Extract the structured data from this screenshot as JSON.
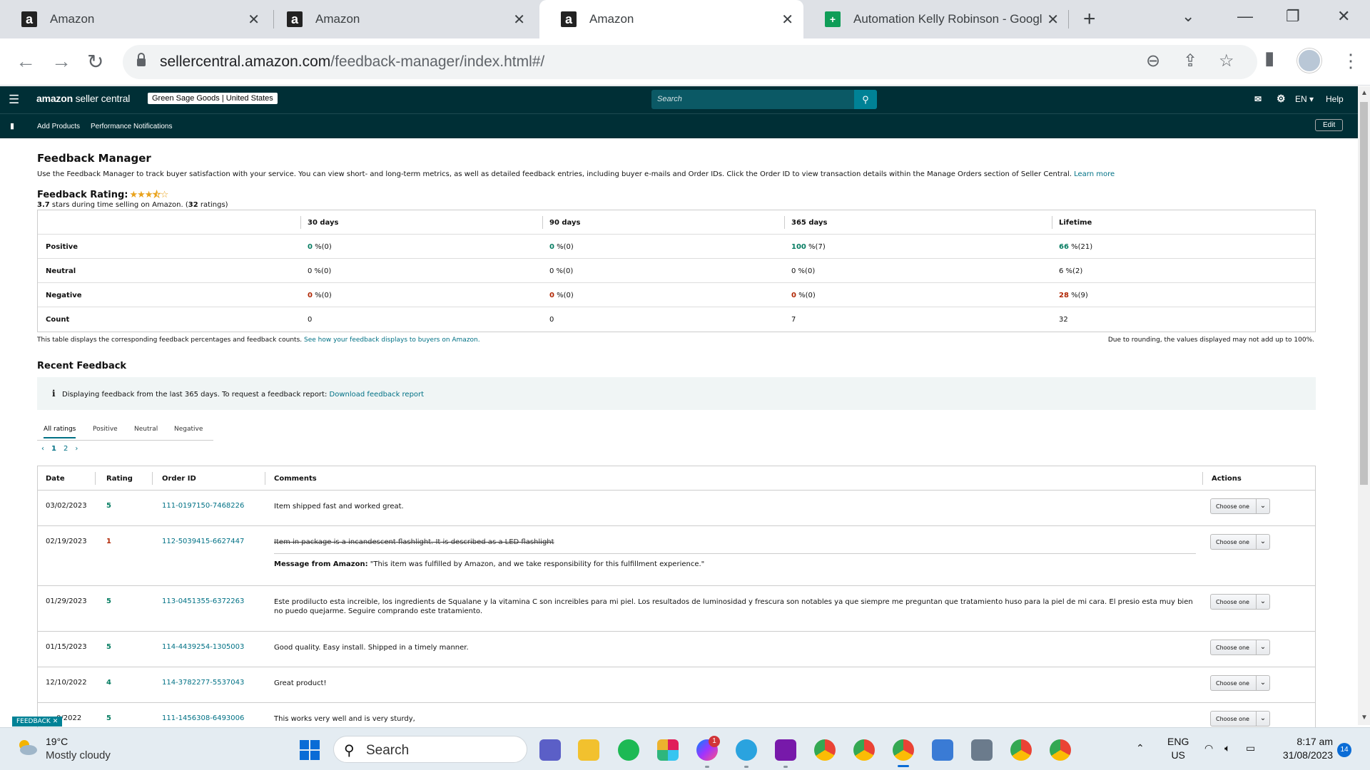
{
  "browser": {
    "tabs": [
      {
        "label": "Amazon",
        "favicon": "a"
      },
      {
        "label": "Amazon",
        "favicon": "a"
      },
      {
        "label": "Amazon",
        "favicon": "a"
      },
      {
        "label": "Automation Kelly Robinson - Googl",
        "favicon": "+"
      }
    ],
    "url_domain": "sellercentral.amazon.com",
    "url_path": "/feedback-manager/index.html#/"
  },
  "header": {
    "logo_main": "amazon",
    "logo_sub": " seller central",
    "store": "Green Sage Goods | United States",
    "search_placeholder": "Search",
    "lang": "EN ▾",
    "help": "Help",
    "nav": [
      "Add Products",
      "Performance Notifications"
    ],
    "edit": "Edit"
  },
  "page": {
    "title": "Feedback Manager",
    "desc": "Use the Feedback Manager to track buyer satisfaction with your service. You can view short- and long-term metrics, as well as detailed feedback entries, including buyer e-mails and Order IDs. Click the Order ID to view transaction details within the Manage Orders section of Seller Central.",
    "learn_more": "Learn more",
    "rating_label": "Feedback Rating:",
    "rating_value": "3.7",
    "rating_mid": " stars during time selling on Amazon. (",
    "rating_count": "32",
    "rating_end": " ratings)"
  },
  "summary": {
    "headers": [
      "30 days",
      "90 days",
      "365 days",
      "Lifetime"
    ],
    "rows": [
      {
        "label": "Positive",
        "cells": [
          [
            "0",
            " %(0)"
          ],
          [
            "0",
            " %(0)"
          ],
          [
            "100",
            " %(7)"
          ],
          [
            "66",
            " %(21)"
          ]
        ],
        "tone": "g"
      },
      {
        "label": "Neutral",
        "cells": [
          [
            "0",
            " %(0)"
          ],
          [
            "0",
            " %(0)"
          ],
          [
            "0",
            " %(0)"
          ],
          [
            "6",
            " %(2)"
          ]
        ],
        "tone": "n"
      },
      {
        "label": "Negative",
        "cells": [
          [
            "0",
            " %(0)"
          ],
          [
            "0",
            " %(0)"
          ],
          [
            "0",
            " %(0)"
          ],
          [
            "28",
            " %(9)"
          ]
        ],
        "tone": "r"
      },
      {
        "label": "Count",
        "cells": [
          [
            "",
            "0"
          ],
          [
            "",
            "0"
          ],
          [
            "",
            "7"
          ],
          [
            "",
            "32"
          ]
        ],
        "tone": "n"
      }
    ],
    "note_left": "This table displays the corresponding feedback percentages and feedback counts.",
    "note_link": "See how your feedback displays to buyers on Amazon.",
    "note_right": "Due to rounding, the values displayed may not add up to 100%."
  },
  "recent": {
    "title": "Recent Feedback",
    "info_icon": "i",
    "info_text": "Displaying feedback from the last 365 days. To request a feedback report:",
    "info_link": "Download feedback report",
    "tabs": [
      "All ratings",
      "Positive",
      "Neutral",
      "Negative"
    ],
    "pages": [
      "‹",
      "1",
      "2",
      "›"
    ],
    "columns": [
      "Date",
      "Rating",
      "Order ID",
      "Comments",
      "Actions"
    ],
    "action_label": "Choose one",
    "rows": [
      {
        "date": "03/02/2023",
        "rating": "5",
        "order": "111-0197150-7468226",
        "comment": "Item shipped fast and worked great."
      },
      {
        "date": "02/19/2023",
        "rating": "1",
        "order": "112-5039415-6627447",
        "comment": "Item in package is a incandescent flashlight. It is described as a LED flashlight",
        "msg_label": "Message from Amazon:",
        "msg_text": " \"This item was fulfilled by Amazon, and we take responsibility for this fulfillment experience.\""
      },
      {
        "date": "01/29/2023",
        "rating": "5",
        "order": "113-0451355-6372263",
        "comment": "Este prodilucto esta increible, los ingredients de Squalane y la vitamina C son increibles para mi piel. Los resultados de luminosidad y frescura son notables ya que siempre me preguntan que tratamiento huso para la piel de mi cara. El presio esta muy bien no puedo quejarme. Seguire comprando este tratamiento."
      },
      {
        "date": "01/15/2023",
        "rating": "5",
        "order": "114-4439254-1305003",
        "comment": "Good quality. Easy install. Shipped in a timely manner."
      },
      {
        "date": "12/10/2022",
        "rating": "4",
        "order": "114-3782277-5537043",
        "comment": "Great product!"
      },
      {
        "date": "0/2022",
        "rating": "5",
        "order": "111-1456308-6493006",
        "comment": "This works very well and is very sturdy,"
      }
    ],
    "feedback_tag": "FEEDBACK ✕"
  },
  "taskbar": {
    "temp": "19°C",
    "weather": "Mostly cloudy",
    "search": "Search",
    "lang1": "ENG",
    "lang2": "US",
    "time": "8:17 am",
    "date": "31/08/2023",
    "notif_count": "14",
    "messenger_badge": "1"
  }
}
